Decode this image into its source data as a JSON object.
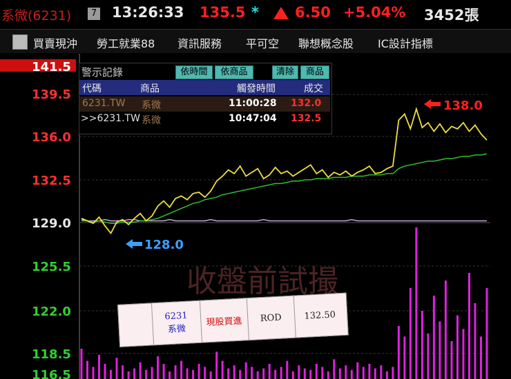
{
  "header": {
    "stock_name": "系微(6231)",
    "badge": "7",
    "time": "13:26:33",
    "price": "135.5",
    "star": "*",
    "change": "6.50",
    "change_pct": "+5.04%",
    "volume": "3452張"
  },
  "menu": {
    "items": [
      "買賣現沖",
      "勞工就業88",
      "資訊服務",
      "平可空",
      "聯想概念股",
      "IC設計指標"
    ]
  },
  "chart_data": {
    "type": "line",
    "y_ticks": [
      "141.5",
      "139.5",
      "136.0",
      "132.5",
      "129.0",
      "125.5",
      "122.0",
      "118.5",
      "116.5"
    ],
    "ylim": [
      116.5,
      141.5
    ],
    "reference": 129.0,
    "high_label": "138.0",
    "low_label": "128.0",
    "watermark": "收盤前試撮",
    "series": [
      {
        "values": [
          129.2,
          129.0,
          128.8,
          129.3,
          128.6,
          128.0,
          128.9,
          129.1,
          128.7,
          129.2,
          129.6,
          129.0,
          129.4,
          130.2,
          130.6,
          130.1,
          130.8,
          131.0,
          130.7,
          131.2,
          131.3,
          130.9,
          131.4,
          132.2,
          132.6,
          133.1,
          132.8,
          133.4,
          132.6,
          132.9,
          133.2,
          132.4,
          132.7,
          133.3,
          132.8,
          133.0,
          132.6,
          132.9,
          133.2,
          133.5,
          132.8,
          133.1,
          132.5,
          132.9,
          132.7,
          133.0,
          132.6,
          132.9,
          133.1,
          133.4,
          132.8,
          132.9,
          133.2,
          133.4,
          137.1,
          137.6,
          136.4,
          138.0,
          136.5,
          136.9,
          136.2,
          136.8,
          136.1,
          136.6,
          136.4,
          136.9,
          136.2,
          136.7,
          136.0,
          135.5
        ]
      },
      {
        "values": [
          129.0,
          129.0,
          128.9,
          129.0,
          128.9,
          128.8,
          128.8,
          128.9,
          128.9,
          128.9,
          129.0,
          129.0,
          129.1,
          129.2,
          129.4,
          129.6,
          129.8,
          130.0,
          130.2,
          130.4,
          130.5,
          130.7,
          130.8,
          130.9,
          131.1,
          131.2,
          131.3,
          131.4,
          131.5,
          131.6,
          131.7,
          131.8,
          131.9,
          132.0,
          132.0,
          132.1,
          132.2,
          132.2,
          132.3,
          132.3,
          132.4,
          132.4,
          132.4,
          132.5,
          132.5,
          132.5,
          132.6,
          132.6,
          132.6,
          132.7,
          132.7,
          132.7,
          132.8,
          132.8,
          133.2,
          133.4,
          133.5,
          133.6,
          133.7,
          133.8,
          133.8,
          133.9,
          134.0,
          134.0,
          134.1,
          134.2,
          134.2,
          134.3,
          134.3,
          134.4
        ]
      },
      {
        "values": [
          129.1,
          129.0,
          129.0,
          129.0,
          129.1,
          129.0,
          129.0,
          129.0,
          129.1,
          129.1,
          129.0,
          129.0,
          129.0,
          129.0,
          129.0,
          129.1,
          129.0,
          129.0,
          129.0,
          129.0,
          129.0,
          129.0,
          129.1,
          129.0,
          129.0,
          129.0,
          129.0,
          129.0,
          129.0,
          129.0,
          129.0,
          129.1,
          129.0,
          129.0,
          129.0,
          129.0,
          129.0,
          129.0,
          129.0,
          129.0,
          129.0,
          129.0,
          129.0,
          129.0,
          129.0,
          129.0,
          129.1,
          129.0,
          129.0,
          129.0,
          129.0,
          129.0,
          129.0,
          129.0,
          129.0,
          129.0,
          129.0,
          129.0,
          129.0,
          129.0,
          129.0,
          129.0,
          129.0,
          129.0,
          129.0,
          129.0,
          129.0,
          129.0,
          129.0,
          129.0
        ]
      }
    ],
    "volume": [
      0.2,
      0.12,
      0.08,
      0.16,
      0.1,
      0.06,
      0.14,
      0.09,
      0.05,
      0.07,
      0.11,
      0.06,
      0.08,
      0.15,
      0.1,
      0.05,
      0.09,
      0.12,
      0.07,
      0.06,
      0.1,
      0.08,
      0.05,
      0.18,
      0.12,
      0.07,
      0.09,
      0.06,
      0.11,
      0.08,
      0.05,
      0.07,
      0.1,
      0.06,
      0.08,
      0.12,
      0.05,
      0.09,
      0.07,
      0.06,
      0.1,
      0.08,
      0.05,
      0.13,
      0.07,
      0.09,
      0.06,
      0.11,
      0.08,
      0.1,
      0.07,
      0.09,
      0.05,
      0.08,
      0.35,
      0.28,
      0.6,
      1.0,
      0.45,
      0.3,
      0.55,
      0.38,
      0.65,
      0.25,
      0.42,
      0.33,
      0.7,
      0.5,
      0.28,
      0.6
    ],
    "colors": {
      "price": "#f0e040",
      "avg": "#30c030",
      "ref": "#c8a8d8",
      "volume": "#e020e0"
    }
  },
  "alerts": {
    "title": "警示記錄",
    "buttons": [
      "依時間",
      "依商品",
      "清除",
      "商品"
    ],
    "columns": [
      "代碼",
      "商品",
      "觸發時間",
      "成交"
    ],
    "rows": [
      {
        "code": "6231.TW",
        "name": "系微",
        "time": "11:00:28",
        "price": "132.0"
      },
      {
        "code": ">>6231.TW",
        "name": "系微",
        "time": "10:47:04",
        "price": "132.5"
      }
    ]
  },
  "order": {
    "code": "6231",
    "name": "系微",
    "type": "現股買進",
    "cond": "ROD",
    "price": "132.50"
  }
}
